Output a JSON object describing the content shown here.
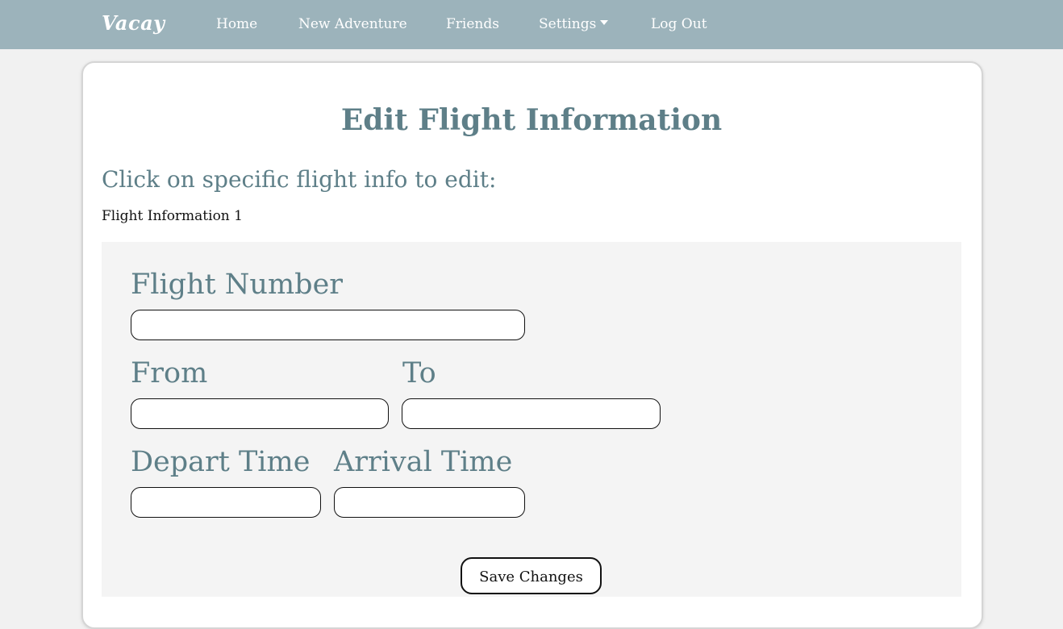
{
  "navbar": {
    "brand": "Vacay",
    "links": {
      "home": "Home",
      "new_adventure": "New Adventure",
      "friends": "Friends",
      "settings": "Settings",
      "log_out": "Log Out"
    }
  },
  "page": {
    "title": "Edit Flight Information",
    "subtitle": "Click on specific flight info to edit:",
    "section_label": "Flight Information 1"
  },
  "form": {
    "flight_number_label": "Flight Number",
    "from_label": "From",
    "to_label": "To",
    "depart_time_label": "Depart Time",
    "arrival_time_label": "Arrival Time",
    "flight_number_value": "",
    "from_value": "",
    "to_value": "",
    "depart_time_value": "",
    "arrival_time_value": "",
    "save_label": "Save Changes"
  },
  "colors": {
    "navbar_bg": "#9cb3bb",
    "accent_text": "#5e7f88",
    "page_bg": "#f1f1f1",
    "panel_bg": "#f4f4f4"
  }
}
